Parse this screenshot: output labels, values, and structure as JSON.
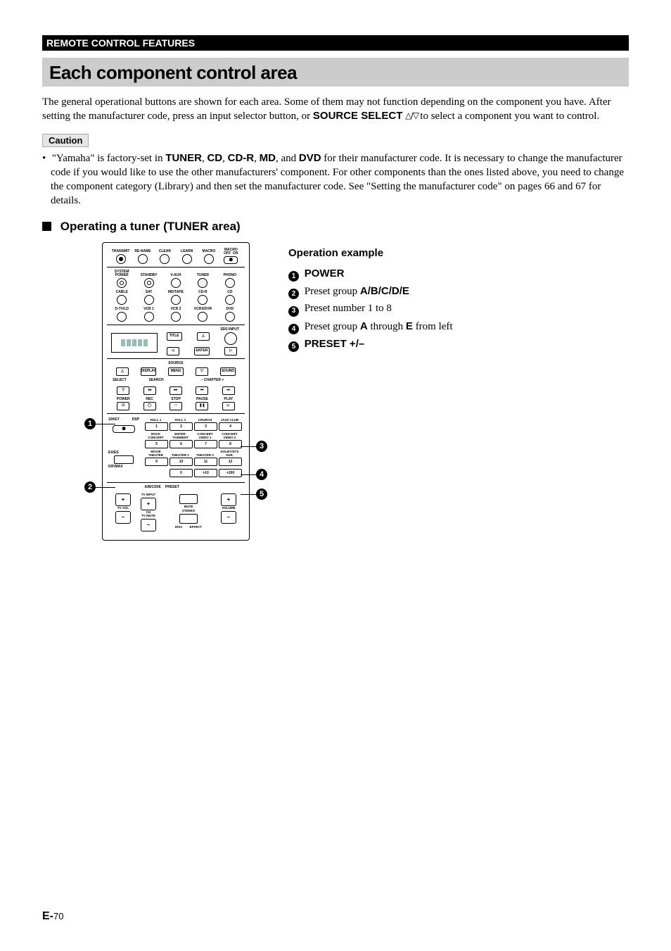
{
  "sectionHeader": "REMOTE CONTROL FEATURES",
  "title": "Each component control area",
  "introParagraph": {
    "prefix": "The general operational buttons are shown for each area. Some of them may not function depending on the component you have. After setting the manufacturer code, press an input selector button, or ",
    "sourceSelect": "SOURCE SELECT",
    "triangles": " △/▽ ",
    "suffix": "to select a component you want to control."
  },
  "cautionLabel": "Caution",
  "cautionItem": {
    "bullet": "•",
    "p1": "\"Yamaha\" is factory-set in ",
    "b1": "TUNER",
    "c1": ", ",
    "b2": "CD",
    "c2": ", ",
    "b3": "CD-R",
    "c3": ", ",
    "b4": "MD",
    "c4": ", and ",
    "b5": "DVD",
    "p2": " for their manufacturer code. It is necessary to change the manufacturer code if you would like to use the other manufacturers' component. For other components than the ones listed above, you need to change the component category (Library) and then set the manufacturer code. See \"Setting the manufacturer code\" on pages 66 and 67 for details."
  },
  "subhead": "Operating a tuner (TUNER area)",
  "remote": {
    "row1": [
      "TRANSMIT",
      "RE-NAME",
      "CLEAR",
      "LEARN",
      "MACRO"
    ],
    "macroOffOn": "MACRO\nOFF  ON",
    "row2": [
      "SYSTEM\nPOWER",
      "STANDBY",
      "V-AUX",
      "TUNER",
      "PHONO"
    ],
    "row3": [
      "CABLE",
      "SAT",
      "MD/TAPE",
      "CD-R",
      "CD"
    ],
    "row4": [
      "D-TV/LD",
      "VCR 1",
      "VCR 2",
      "VCR3/DVR",
      "DVD"
    ],
    "sdsInput": "SDS INPUT",
    "title": "TITLE",
    "enter": "ENTER",
    "source": "SOURCE",
    "display": "DISPLAY",
    "menu": "MENU",
    "sound": "SOUND",
    "select": "SELECT",
    "search": "SEARCH",
    "chapter": "–  CHAPTER  +",
    "rowTransport": [
      "POWER",
      "REC",
      "STOP",
      "PAUSE",
      "PLAY"
    ],
    "tenkey": "10KEY",
    "dsp": "DSP",
    "dspRowTop": [
      "HALL 1",
      "HALL 2",
      "CHURCH",
      "JAZZ CLUB"
    ],
    "dspRowTopNum": [
      "1",
      "2",
      "3",
      "4"
    ],
    "dspRowMid": [
      "ROCK\nCONCERT",
      "ENTER-\nTAINMENT",
      "CONCERT\nVIDEO 1",
      "CONCERT\nVIDEO 2"
    ],
    "dspRowMidNum": [
      "5",
      "6",
      "7",
      "8"
    ],
    "exes": "EX/ES",
    "dspRowBot": [
      "MOVIE\nTHEATER",
      "THEATER 1",
      "THEATER 2",
      "DOLBY/DTS\nSUR."
    ],
    "dspRowBotNum": [
      "9",
      "10",
      "11",
      "12"
    ],
    "dspRow4": [
      "",
      "0",
      "+10",
      "+100"
    ],
    "dhmax": "D/F/MAX",
    "abcde": "A/B/C/D/E",
    "preset": "PRESET",
    "tvInput": "TV INPUT",
    "tvVol": "TV VOL",
    "tvMute": "TV MUTE",
    "ch": "CH",
    "mute": "MUTE",
    "stereo": "STEREO",
    "disc": "DISC",
    "effect": "EFFECT",
    "volume": "VOLUME",
    "plus": "+",
    "minus": "–"
  },
  "callouts": {
    "m1": "1",
    "m2": "2",
    "m3": "3",
    "m4": "4",
    "m5": "5"
  },
  "operationExample": {
    "heading": "Operation example",
    "lines": [
      {
        "num": "1",
        "bold": "POWER",
        "rest": ""
      },
      {
        "num": "2",
        "bold": "A/B/C/D/E",
        "pre": "Preset group ",
        "rest": ""
      },
      {
        "num": "3",
        "bold": "",
        "pre": "Preset number 1 to 8",
        "rest": ""
      },
      {
        "num": "4",
        "bold": "A",
        "pre": "Preset group ",
        "mid": " through ",
        "bold2": "E",
        "rest": " from left"
      },
      {
        "num": "5",
        "bold": "PRESET +/–",
        "rest": ""
      }
    ]
  },
  "pagePrefix": "E-",
  "pageNumber": "70"
}
